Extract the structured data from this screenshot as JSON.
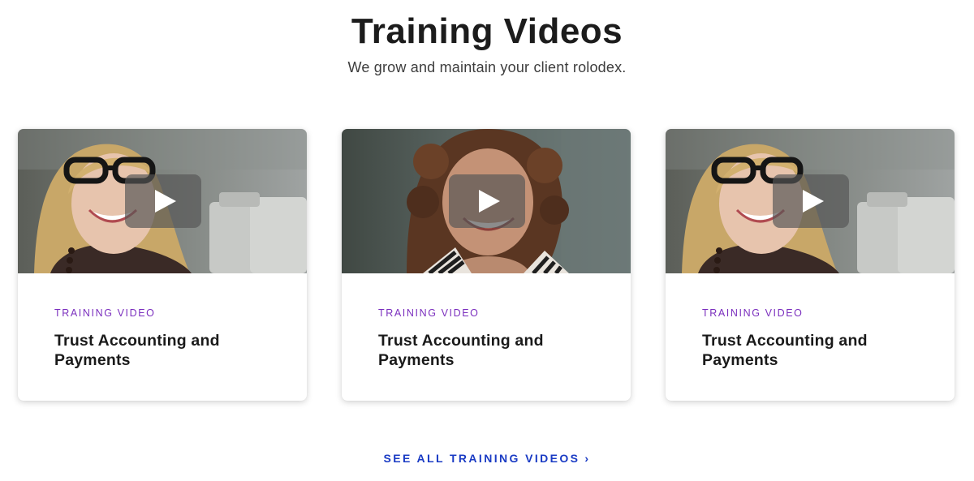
{
  "page": {
    "title": "Training Videos",
    "subtitle": "We grow and maintain your client rolodex."
  },
  "cards": [
    {
      "eyebrow": "TRAINING VIDEO",
      "title": "Trust Accounting and Payments",
      "thumbnail": "woman-with-glasses-smiling",
      "play_icon": "play-icon"
    },
    {
      "eyebrow": "TRAINING VIDEO",
      "title": "Trust Accounting and Payments",
      "thumbnail": "woman-with-curly-hair-smiling",
      "play_icon": "play-icon"
    },
    {
      "eyebrow": "TRAINING VIDEO",
      "title": "Trust Accounting and Payments",
      "thumbnail": "woman-with-glasses-smiling",
      "play_icon": "play-icon"
    }
  ],
  "footer_link": {
    "label": "SEE ALL TRAINING VIDEOS",
    "icon": "chevron-right-icon",
    "glyph": "›"
  },
  "colors": {
    "eyebrow": "#7b2fbe",
    "link": "#1a3bc4",
    "heading": "#1c1c1c"
  }
}
